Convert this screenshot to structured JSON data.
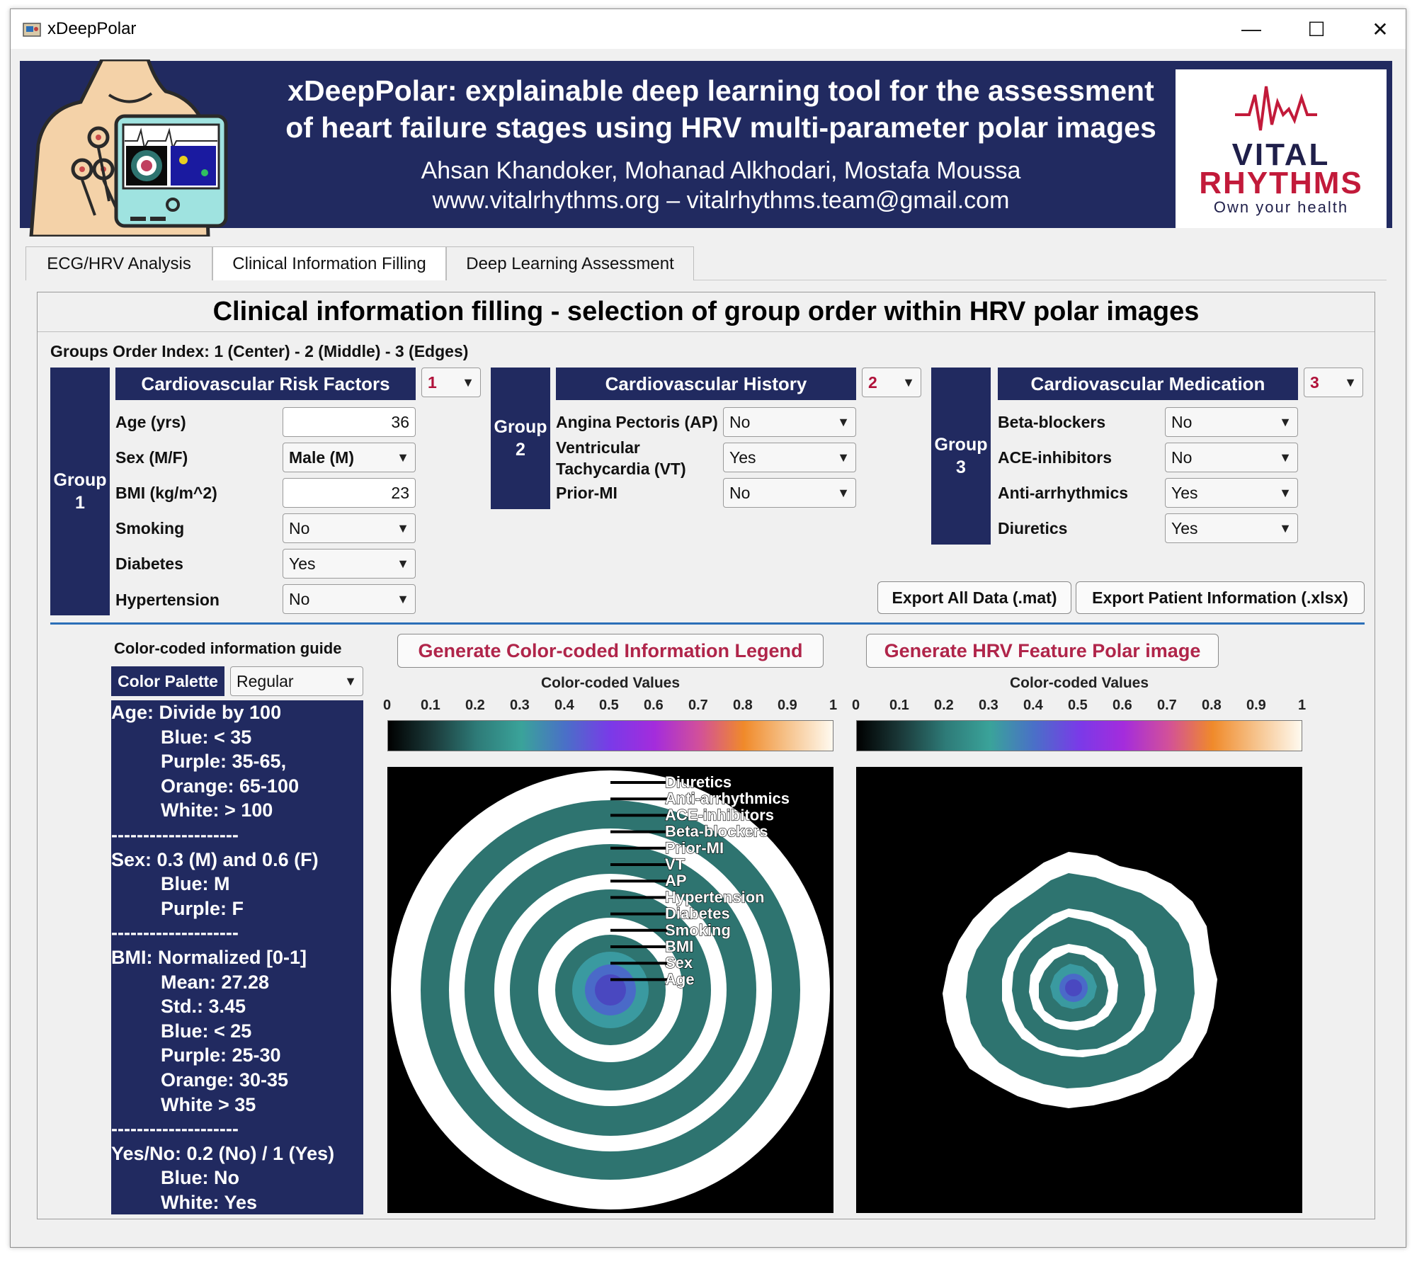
{
  "window": {
    "title": "xDeepPolar",
    "controls": [
      "—",
      "☐",
      "✕"
    ]
  },
  "banner": {
    "title_line1": "xDeepPolar: explainable deep learning tool for the assessment",
    "title_line2": "of heart failure stages using HRV multi-parameter polar images",
    "authors": "Ahsan Khandoker, Mohanad Alkhodari, Mostafa Moussa",
    "contact": "www.vitalrhythms.org – vitalrhythms.team@gmail.com",
    "logo_line1": "VITAL",
    "logo_line2": "RHYTHMS",
    "logo_tagline": "Own your health"
  },
  "tabs": [
    {
      "label": "ECG/HRV Analysis",
      "active": false
    },
    {
      "label": "Clinical Information Filling",
      "active": true
    },
    {
      "label": "Deep Learning Assessment",
      "active": false
    }
  ],
  "panel": {
    "heading": "Clinical information filling - selection of group order within HRV polar images",
    "order_index": "Groups Order Index: 1 (Center) - 2 (Middle) - 3 (Edges)"
  },
  "group1": {
    "label1": "Group",
    "label2": "1",
    "header": "Cardiovascular Risk Factors",
    "order": "1",
    "fields": [
      {
        "label": "Age (yrs)",
        "value": "36",
        "type": "number"
      },
      {
        "label": "Sex (M/F)",
        "value": "Male (M)",
        "type": "select"
      },
      {
        "label": "BMI (kg/m^2)",
        "value": "23",
        "type": "number"
      },
      {
        "label": "Smoking",
        "value": "No",
        "type": "select"
      },
      {
        "label": "Diabetes",
        "value": "Yes",
        "type": "select"
      },
      {
        "label": "Hypertension",
        "value": "No",
        "type": "select"
      }
    ]
  },
  "group2": {
    "label1": "Group",
    "label2": "2",
    "header": "Cardiovascular History",
    "order": "2",
    "fields": [
      {
        "label": "Angina Pectoris (AP)",
        "value": "No"
      },
      {
        "label": "Ventricular",
        "label2": "Tachycardia (VT)",
        "value": "Yes"
      },
      {
        "label": "Prior-MI",
        "value": "No"
      }
    ]
  },
  "group3": {
    "label1": "Group",
    "label2": "3",
    "header": "Cardiovascular Medication",
    "order": "3",
    "fields": [
      {
        "label": "Beta-blockers",
        "value": "No"
      },
      {
        "label": "ACE-inhibitors",
        "value": "No"
      },
      {
        "label": "Anti-arrhythmics",
        "value": "Yes"
      },
      {
        "label": "Diuretics",
        "value": "Yes"
      }
    ]
  },
  "export": {
    "mat_label": "Export All Data (.mat)",
    "xlsx_label": "Export Patient Information (.xlsx)"
  },
  "guide": {
    "title": "Color-coded information guide",
    "palette_label": "Color Palette",
    "palette_value": "Regular",
    "lines": [
      {
        "text": "Age: Divide by 100",
        "indent": false
      },
      {
        "text": "Blue: < 35",
        "indent": true
      },
      {
        "text": "Purple: 35-65,",
        "indent": true
      },
      {
        "text": "Orange: 65-100",
        "indent": true
      },
      {
        "text": "White: > 100",
        "indent": true
      },
      {
        "text": "--------------------",
        "indent": false
      },
      {
        "text": "Sex: 0.3 (M) and 0.6 (F)",
        "indent": false
      },
      {
        "text": "Blue: M",
        "indent": true
      },
      {
        "text": "Purple: F",
        "indent": true
      },
      {
        "text": "--------------------",
        "indent": false
      },
      {
        "text": "BMI: Normalized [0-1]",
        "indent": false
      },
      {
        "text": "Mean: 27.28",
        "indent": true
      },
      {
        "text": "Std.: 3.45",
        "indent": true
      },
      {
        "text": "Blue: < 25",
        "indent": true
      },
      {
        "text": "Purple: 25-30",
        "indent": true
      },
      {
        "text": "Orange: 30-35",
        "indent": true
      },
      {
        "text": "White > 35",
        "indent": true
      },
      {
        "text": "--------------------",
        "indent": false
      },
      {
        "text": "Yes/No: 0.2 (No) / 1 (Yes)",
        "indent": false
      },
      {
        "text": "Blue: No",
        "indent": true
      },
      {
        "text": "White: Yes",
        "indent": true
      }
    ]
  },
  "legend_button": "Generate Color-coded Information Legend",
  "polar_button": "Generate HRV Feature Polar image",
  "colorbar": {
    "title": "Color-coded Values",
    "ticks": [
      "0",
      "0.1",
      "0.2",
      "0.3",
      "0.4",
      "0.5",
      "0.6",
      "0.7",
      "0.8",
      "0.9",
      "1"
    ],
    "colors": [
      "#000000",
      "#1b3a3a",
      "#2e7b78",
      "#3aa39a",
      "#4a6fc8",
      "#7a3ae8",
      "#a42cdc",
      "#d2509a",
      "#f08a2a",
      "#f6c48e",
      "#fffaf0"
    ]
  },
  "legend_labels": [
    "Diuretics",
    "Anti-arrhythmics",
    "ACE-inhibitors",
    "Beta-blockers",
    "Prior-MI",
    "VT",
    "AP",
    "Hypertension",
    "Diabetes",
    "Smoking",
    "BMI",
    "Sex",
    "Age"
  ],
  "colors": {
    "navy": "#212a60",
    "teal": "#2e7470",
    "accent_red": "#b0254a",
    "divider": "#2c6fb8"
  }
}
